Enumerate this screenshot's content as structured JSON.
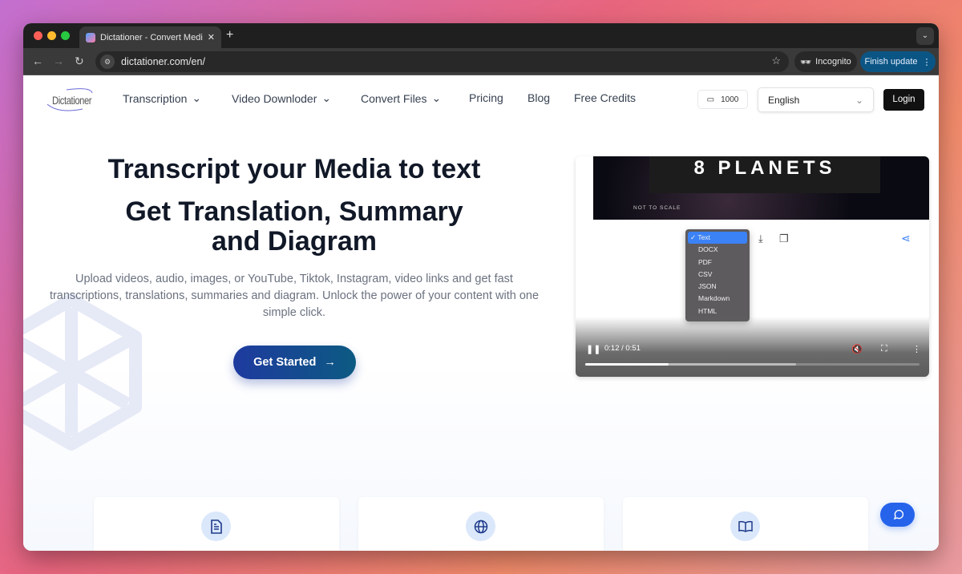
{
  "browser": {
    "tab_title": "Dictationer - Convert Media & Video",
    "url": "dictationer.com/en/",
    "incognito_label": "Incognito",
    "update_label": "Finish update"
  },
  "header": {
    "logo_text": "Dictationer",
    "nav": [
      {
        "label": "Transcription",
        "has_dropdown": true
      },
      {
        "label": "Video Downloder",
        "has_dropdown": true
      },
      {
        "label": "Convert Files",
        "has_dropdown": true
      },
      {
        "label": "Pricing"
      },
      {
        "label": "Blog"
      },
      {
        "label": "Free Credits"
      }
    ],
    "credits": "1000",
    "language": "English",
    "login_label": "Login"
  },
  "hero": {
    "title": "Transcript your Media to text",
    "subtitle": "Get Translation, Summary and Diagram",
    "description": "Upload videos, audio, images, or YouTube, Tiktok, Instagram, video links and get fast transcriptions, translations, summaries and diagram. Unlock the power of your content with one simple click.",
    "cta_label": "Get Started"
  },
  "video": {
    "title_card": "8 PLANETS",
    "caption": "NOT TO SCALE",
    "time": "0:12 / 0:51",
    "progress_percent": 25,
    "buffered_percent": 63,
    "format_menu": {
      "selected": "Text",
      "options": [
        "Text",
        "DOCX",
        "PDF",
        "CSV",
        "JSON",
        "Markdown",
        "HTML"
      ]
    }
  },
  "features": [
    {
      "icon": "document-icon"
    },
    {
      "icon": "globe-icon"
    },
    {
      "icon": "book-icon"
    }
  ],
  "colors": {
    "accent": "#2563eb",
    "cta_start": "#1e3a9f",
    "cta_end": "#0c5a82"
  }
}
